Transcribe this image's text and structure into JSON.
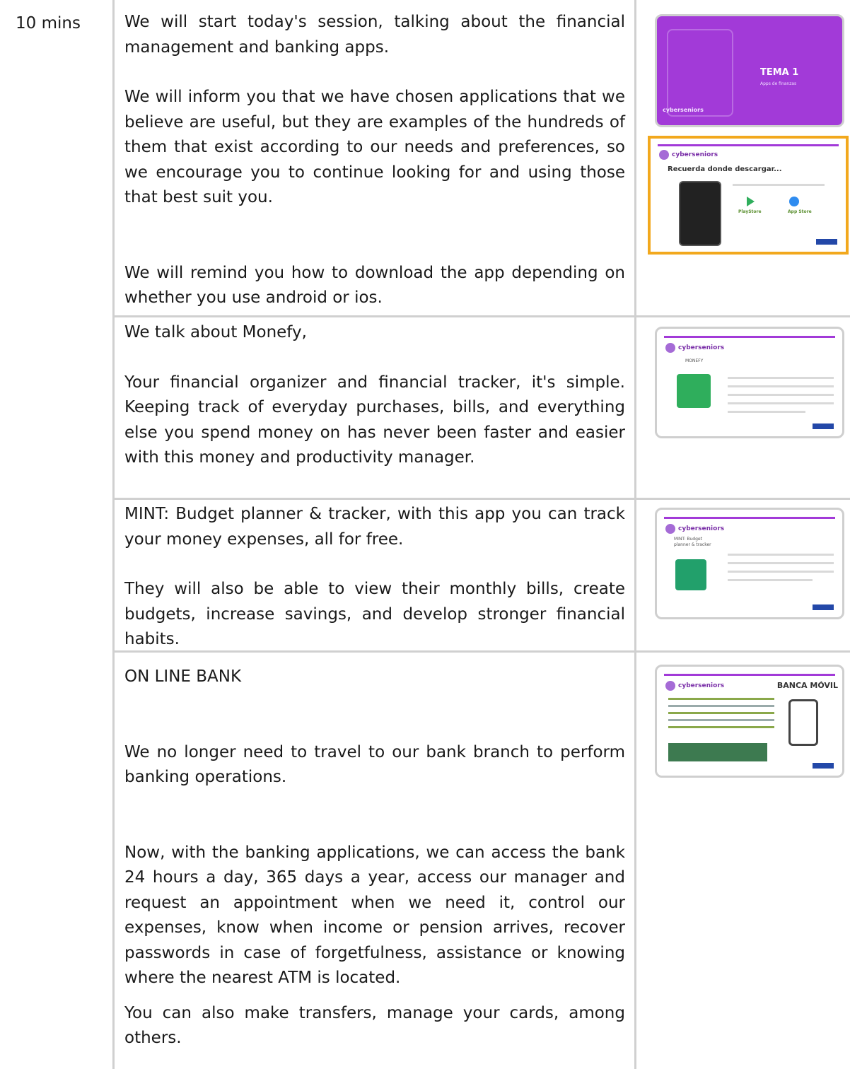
{
  "time_label": "10 mins",
  "rows": [
    {
      "paragraphs": [
        "We will start today's session, talking about the financial management and banking apps.",
        "We will inform you that we have chosen applications that we believe are useful, but they are  examples of the hundreds of them that exist according to our needs and preferences, so we encourage you to continue looking for and using those that best suit you.",
        "We will remind you how to download the app depending on whether you use android or ios."
      ]
    },
    {
      "paragraphs": [
        "We talk about  Monefy,",
        "Your financial organizer and financial tracker, it's simple. Keeping track of everyday purchases, bills, and everything else you spend money on has never been faster and easier with this money and productivity manager."
      ]
    },
    {
      "paragraphs": [
        "MINT: Budget planner & tracker, with this app you can track your money expenses, all for free.",
        "They will also be able to view their monthly bills, create budgets, increase savings, and develop stronger financial habits."
      ]
    },
    {
      "paragraphs": [
        "ON LINE BANK",
        "We no longer need to travel to our bank branch to perform banking operations.",
        "Now, with the banking applications, we can access the bank 24 hours a day, 365 days a year, access our manager and request an appointment when we need it, control our expenses, know when income or pension arrives, recover passwords in case of forgetfulness, assistance or knowing where the nearest ATM is located.",
        "You can also make transfers, manage your cards, among others."
      ]
    }
  ],
  "thumbnails": {
    "tema": {
      "title": "TEMA 1",
      "subtitle": "Apps de finanzas",
      "brand": "cyberseniors"
    },
    "download": {
      "brand": "cyberseniors",
      "title": "Recuerda donde descargar...",
      "play": "PlayStore",
      "app": "App Store"
    },
    "monefy": {
      "brand": "cyberseniors",
      "label": "MONEFY"
    },
    "mint": {
      "brand": "cyberseniors",
      "label": "MINT: Budget planner & tracker"
    },
    "banca": {
      "brand": "cyberseniors",
      "title": "BANCA MÓVIL"
    }
  },
  "colors": {
    "grid": "#d0d0d0",
    "tema_purple": "#a23ad8",
    "highlight_border": "#f2a81d",
    "monefy_green": "#2fae5c",
    "mint_green": "#22a06b"
  }
}
